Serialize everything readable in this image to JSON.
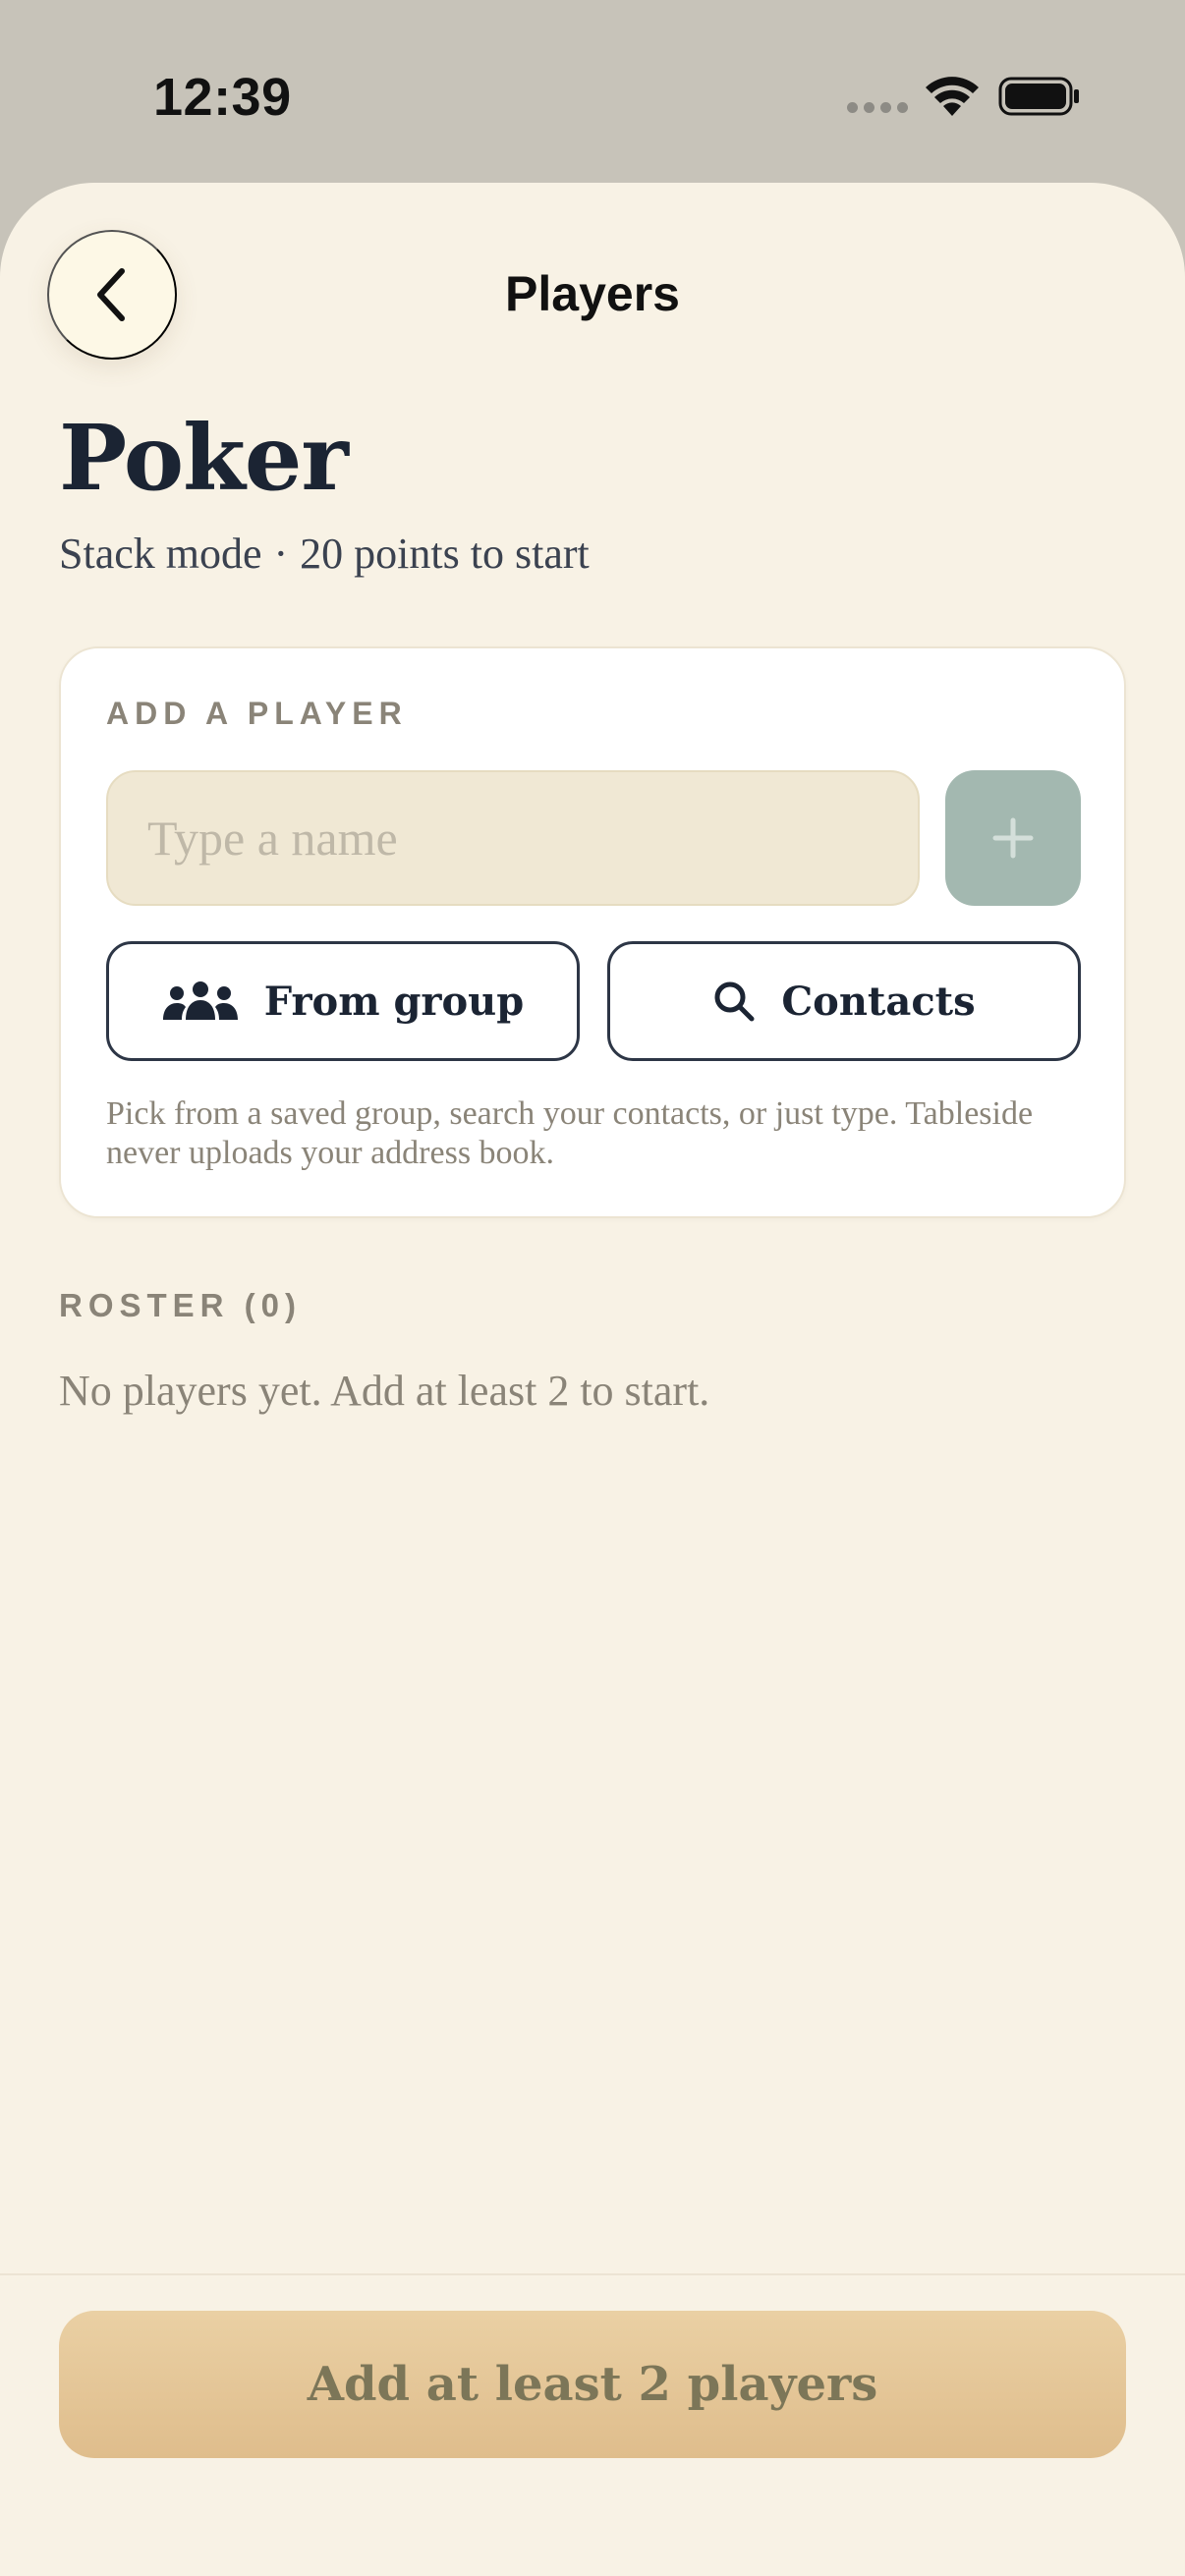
{
  "status_bar": {
    "time": "12:39"
  },
  "nav": {
    "title": "Players",
    "back_icon": "chevron-left-icon"
  },
  "game": {
    "title": "Poker",
    "mode": "Stack mode",
    "separator": "·",
    "start_points": "20 points to start"
  },
  "add_player": {
    "label": "ADD A PLAYER",
    "input_placeholder": "Type a name",
    "input_value": "",
    "add_icon": "plus-icon",
    "from_group_label": "From group",
    "from_group_icon": "people-icon",
    "contacts_label": "Contacts",
    "contacts_icon": "search-icon",
    "hint": "Pick from a saved group, search your contacts, or just type. Tableside never uploads your address book."
  },
  "roster": {
    "label": "ROSTER (0)",
    "empty_message": "No players yet. Add at least 2 to start."
  },
  "cta": {
    "label": "Add at least 2 players"
  },
  "colors": {
    "background": "#f8f2e5",
    "ink": "#1b2433",
    "muted": "#8a8478",
    "add_button": "#a3b8b0",
    "cta": "#e4c697"
  }
}
